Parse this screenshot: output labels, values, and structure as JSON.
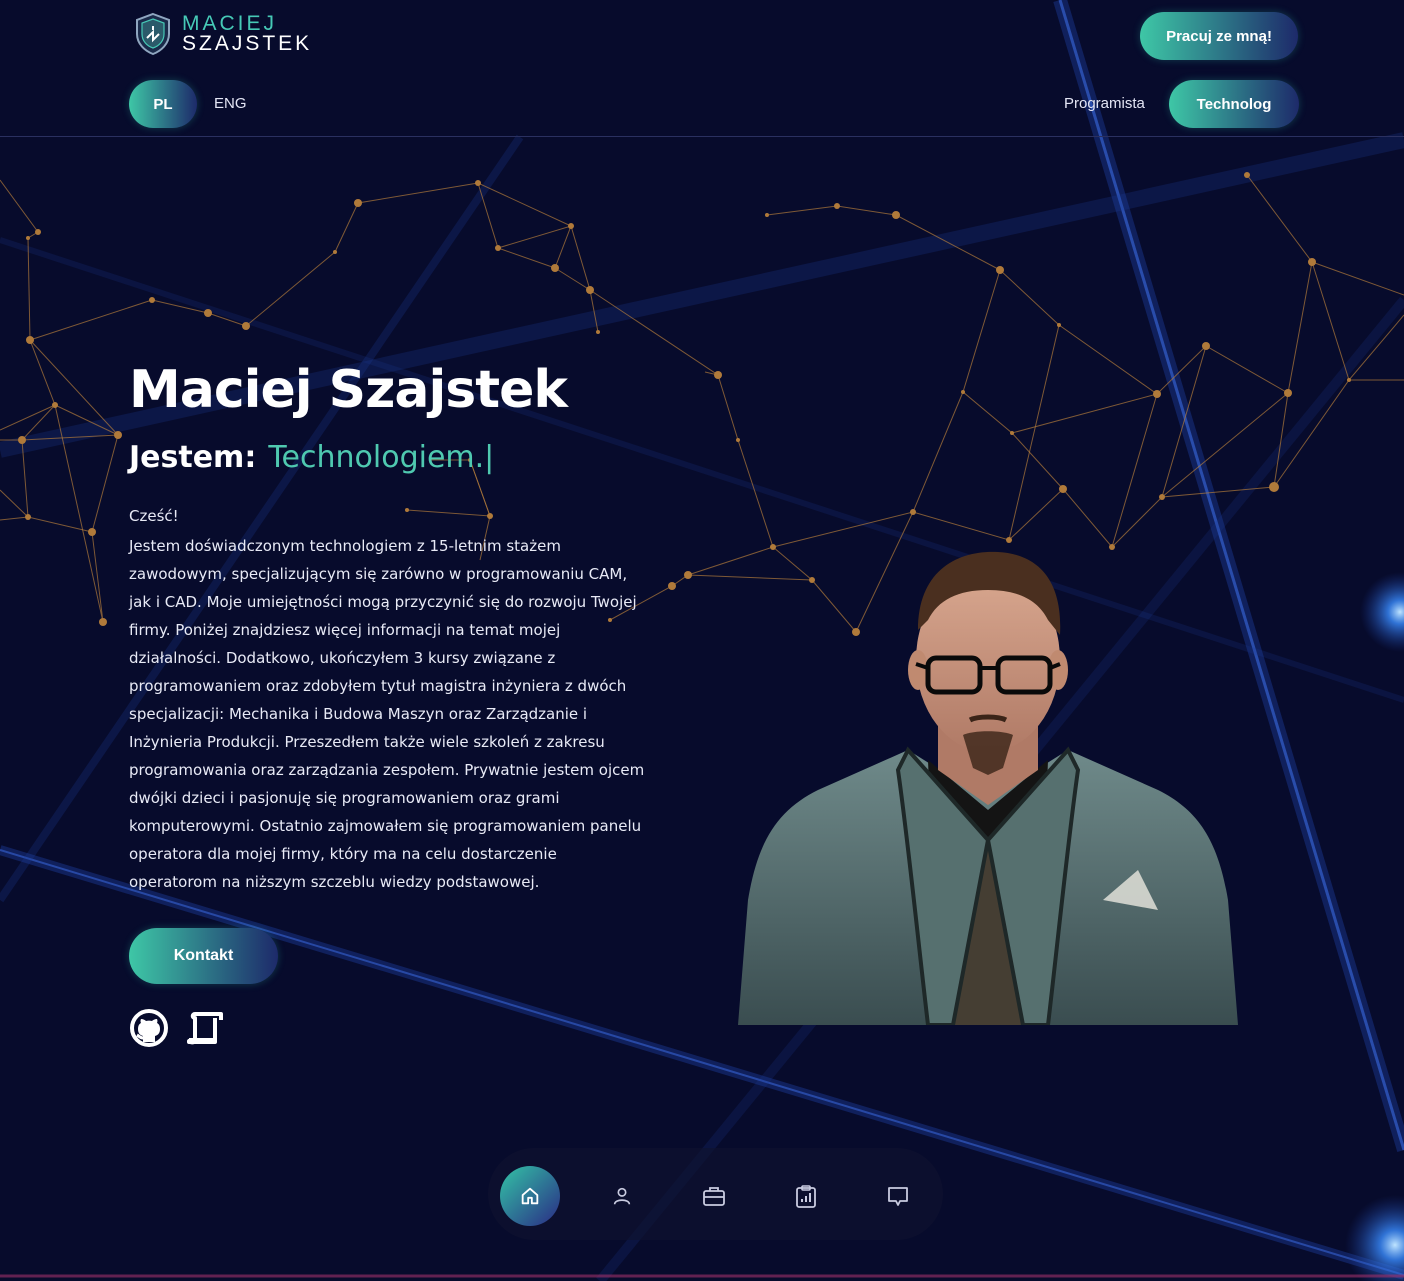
{
  "brand": {
    "name_line1": "MACIEJ",
    "name_line2": "SZAJSTEK",
    "logo_icon": "shield-logo-icon"
  },
  "header": {
    "cta_label": "Pracuj ze mną!",
    "languages": [
      "PL",
      "ENG"
    ],
    "active_language": "PL",
    "roles": [
      "Programista",
      "Technolog"
    ],
    "active_role": "Technolog"
  },
  "hero": {
    "name": "Maciej Szajstek",
    "iam_label": "Jestem:",
    "iam_value": "Technologiem.|",
    "greeting": "Cześć!",
    "bio": "Jestem doświadczonym technologiem z 15-letnim stażem zawodowym, specjalizującym się zarówno w programowaniu CAM, jak i CAD. Moje umiejętności mogą przyczynić się do rozwoju Twojej firmy. Poniżej znajdziesz więcej informacji na temat mojej działalności. Dodatkowo, ukończyłem 3 kursy związane z programowaniem oraz zdobyłem tytuł magistra inżyniera z dwóch specjalizacji: Mechanika i Budowa Maszyn oraz Zarządzanie i Inżynieria Produkcji. Przeszedłem także wiele szkoleń z zakresu programowania oraz zarządzania zespołem. Prywatnie jestem ojcem dwójki dzieci i pasjonuję się programowaniem oraz grami komputerowymi. Ostatnio zajmowałem się programowaniem panelu operatora dla mojej firmy, który ma na celu dostarczenie operatorom na niższym szczeblu wiedzy podstawowej.",
    "contact_label": "Kontakt",
    "social_icons": [
      "github-icon",
      "cv-scroll-icon"
    ]
  },
  "bottom_nav": {
    "items": [
      "home-icon",
      "user-icon",
      "briefcase-icon",
      "clipboard-chart-icon",
      "chat-icon"
    ],
    "active": "home-icon"
  },
  "colors": {
    "background": "#070b2c",
    "accent": "#4fc9b0",
    "button_gradient_start": "#3ec7a6",
    "button_gradient_end": "#1d2a6a",
    "network_dots": "#b07a3a"
  }
}
